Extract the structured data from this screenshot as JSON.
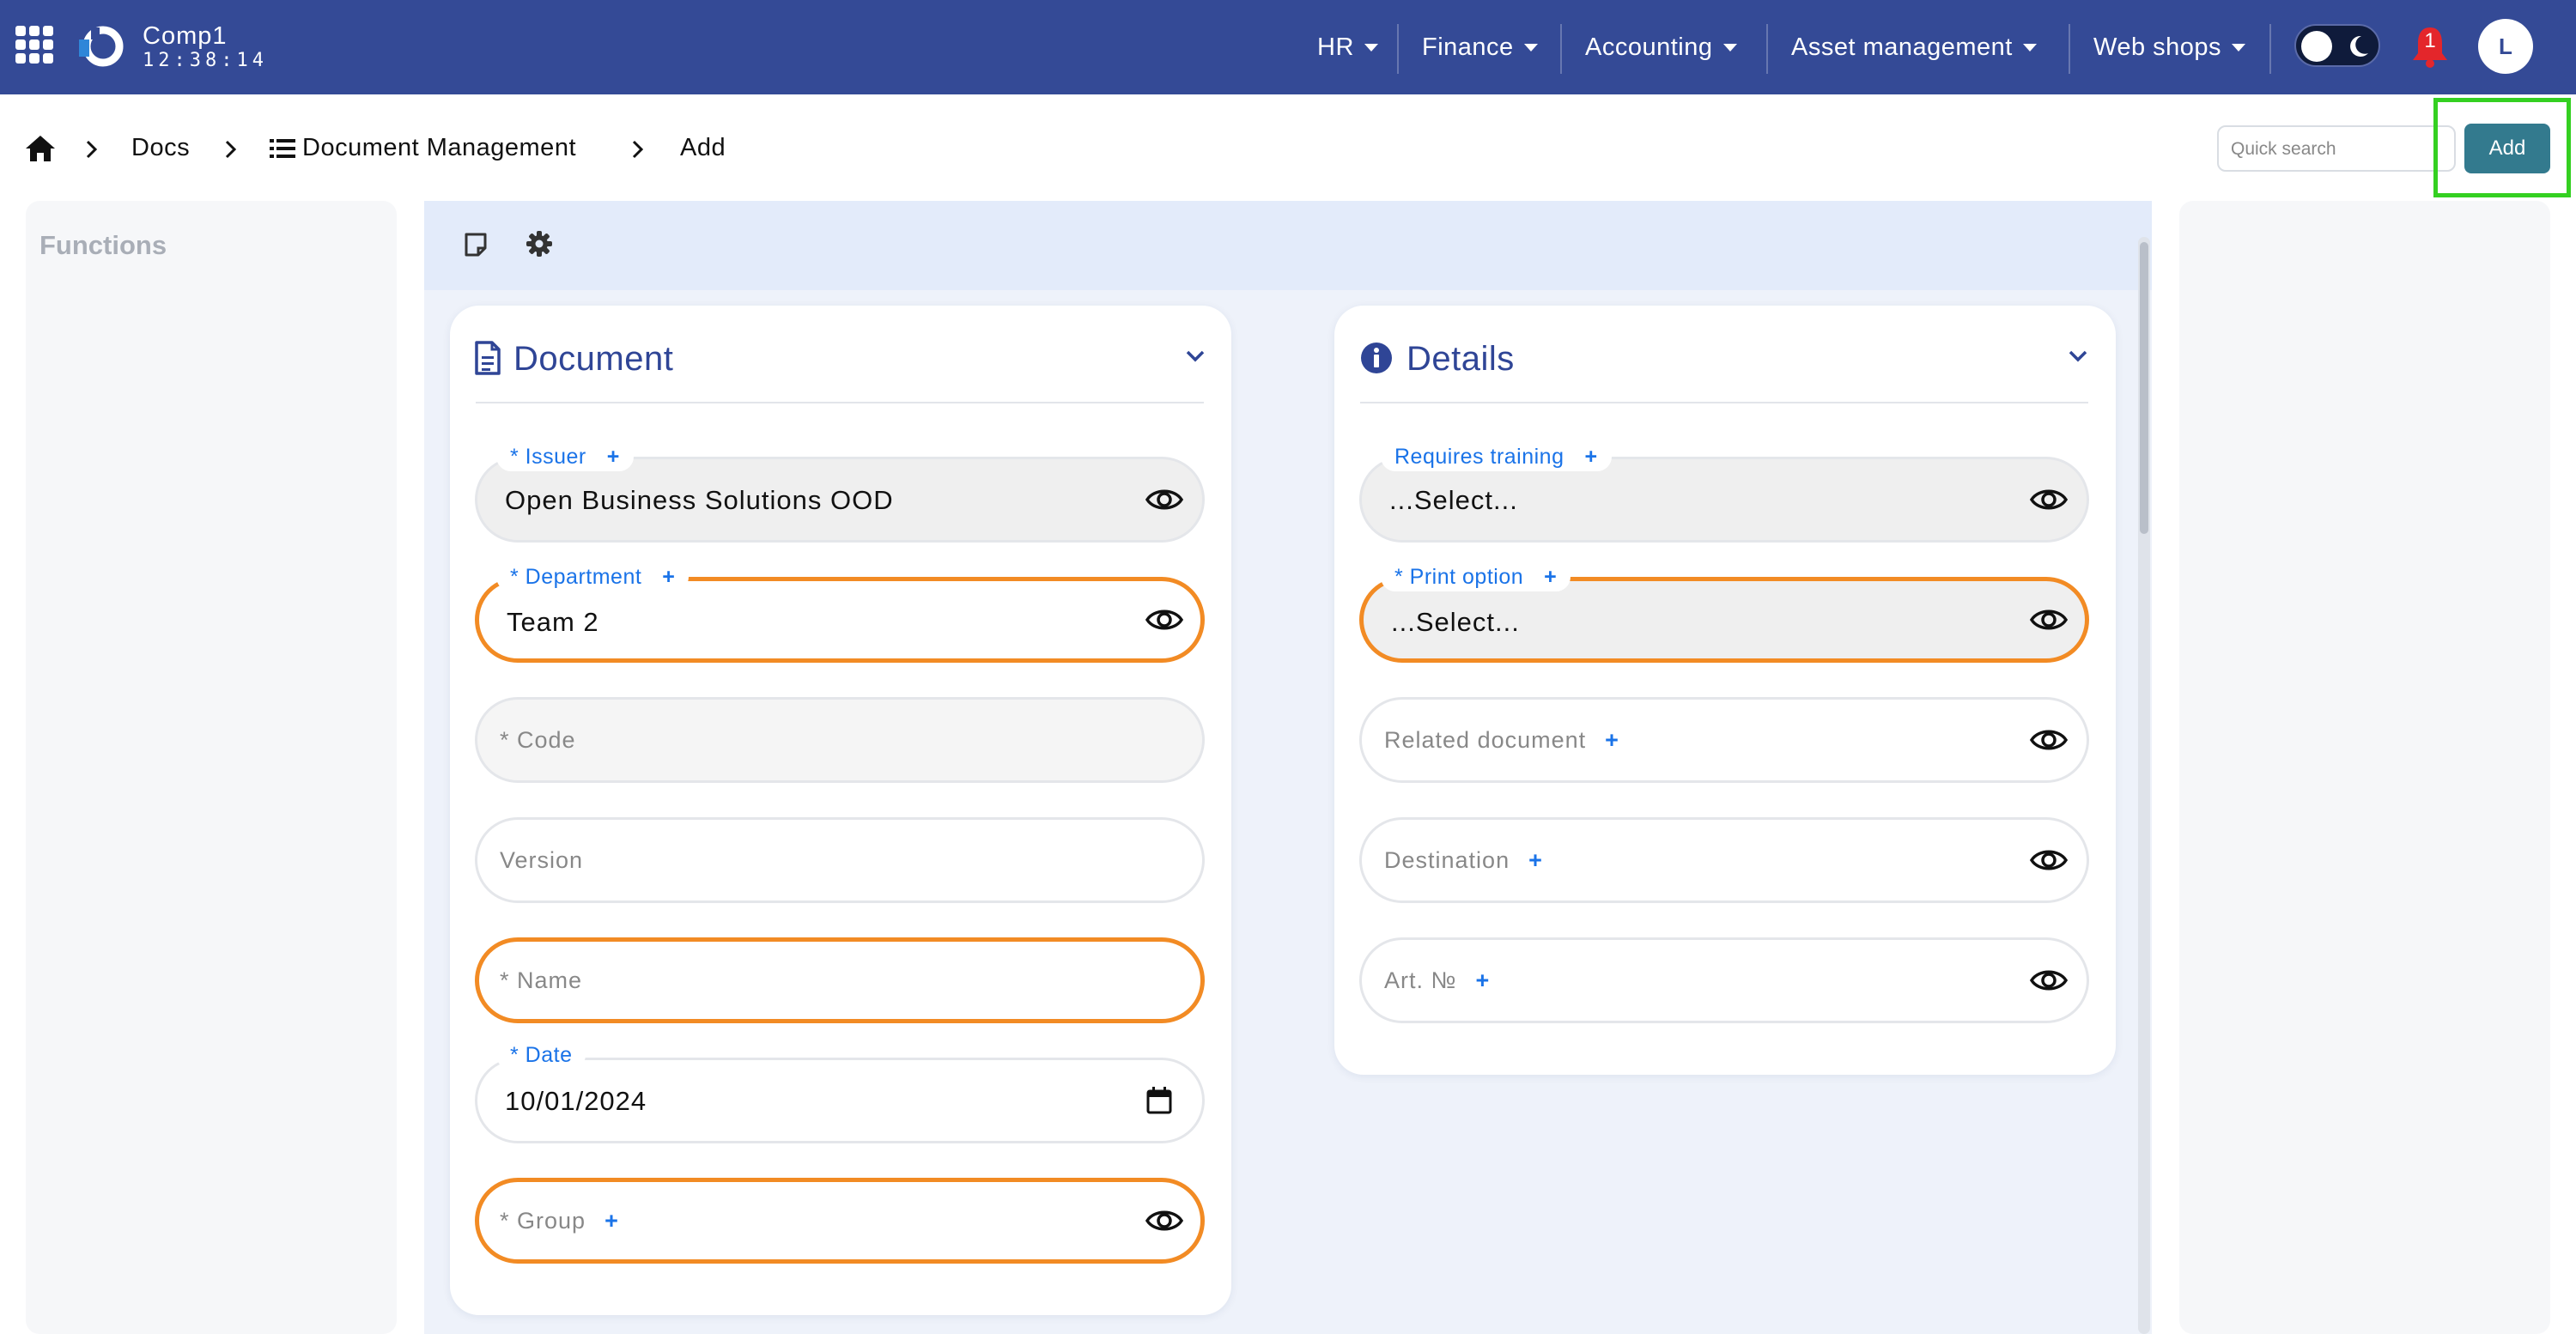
{
  "header": {
    "company": "Comp1",
    "clock": "12:38:14",
    "nav": [
      "HR",
      "Finance",
      "Accounting",
      "Asset management",
      "Web shops"
    ],
    "notification_count": "1",
    "avatar_letter": "L"
  },
  "breadcrumb": {
    "docs": "Docs",
    "module": "Document Management",
    "current": "Add"
  },
  "search": {
    "placeholder": "Quick search"
  },
  "add_button": "Add",
  "functions_title": "Functions",
  "document_card": {
    "title": "Document",
    "issuer": {
      "label": "* Issuer",
      "value": "Open Business Solutions OOD"
    },
    "department": {
      "label": "* Department",
      "value": "Team 2"
    },
    "code": {
      "placeholder": "* Code"
    },
    "version": {
      "placeholder": "Version"
    },
    "name": {
      "placeholder": "* Name"
    },
    "date": {
      "label": "* Date",
      "value": "10/01/2024"
    },
    "group": {
      "placeholder": "* Group"
    }
  },
  "details_card": {
    "title": "Details",
    "requires_training": {
      "label": "Requires training",
      "value": "...Select..."
    },
    "print_option": {
      "label": "* Print option",
      "value": "...Select..."
    },
    "related_document": {
      "placeholder": "Related document"
    },
    "destination": {
      "placeholder": "Destination"
    },
    "art_no": {
      "placeholder": "Art. №"
    }
  },
  "colors": {
    "header_bg": "#344a96",
    "accent_blue": "#1a73e8",
    "required_orange": "#f28b24",
    "add_button": "#337a8e",
    "highlight": "#34d021"
  },
  "icons": [
    "apps-grid-icon",
    "logo-icon",
    "caret-down-icon",
    "toggle-moon-icon",
    "bell-icon",
    "home-icon",
    "chevron-right-icon",
    "list-icon",
    "note-icon",
    "gear-icon",
    "file-icon",
    "info-icon",
    "chevron-down-icon",
    "eye-icon",
    "calendar-icon"
  ]
}
